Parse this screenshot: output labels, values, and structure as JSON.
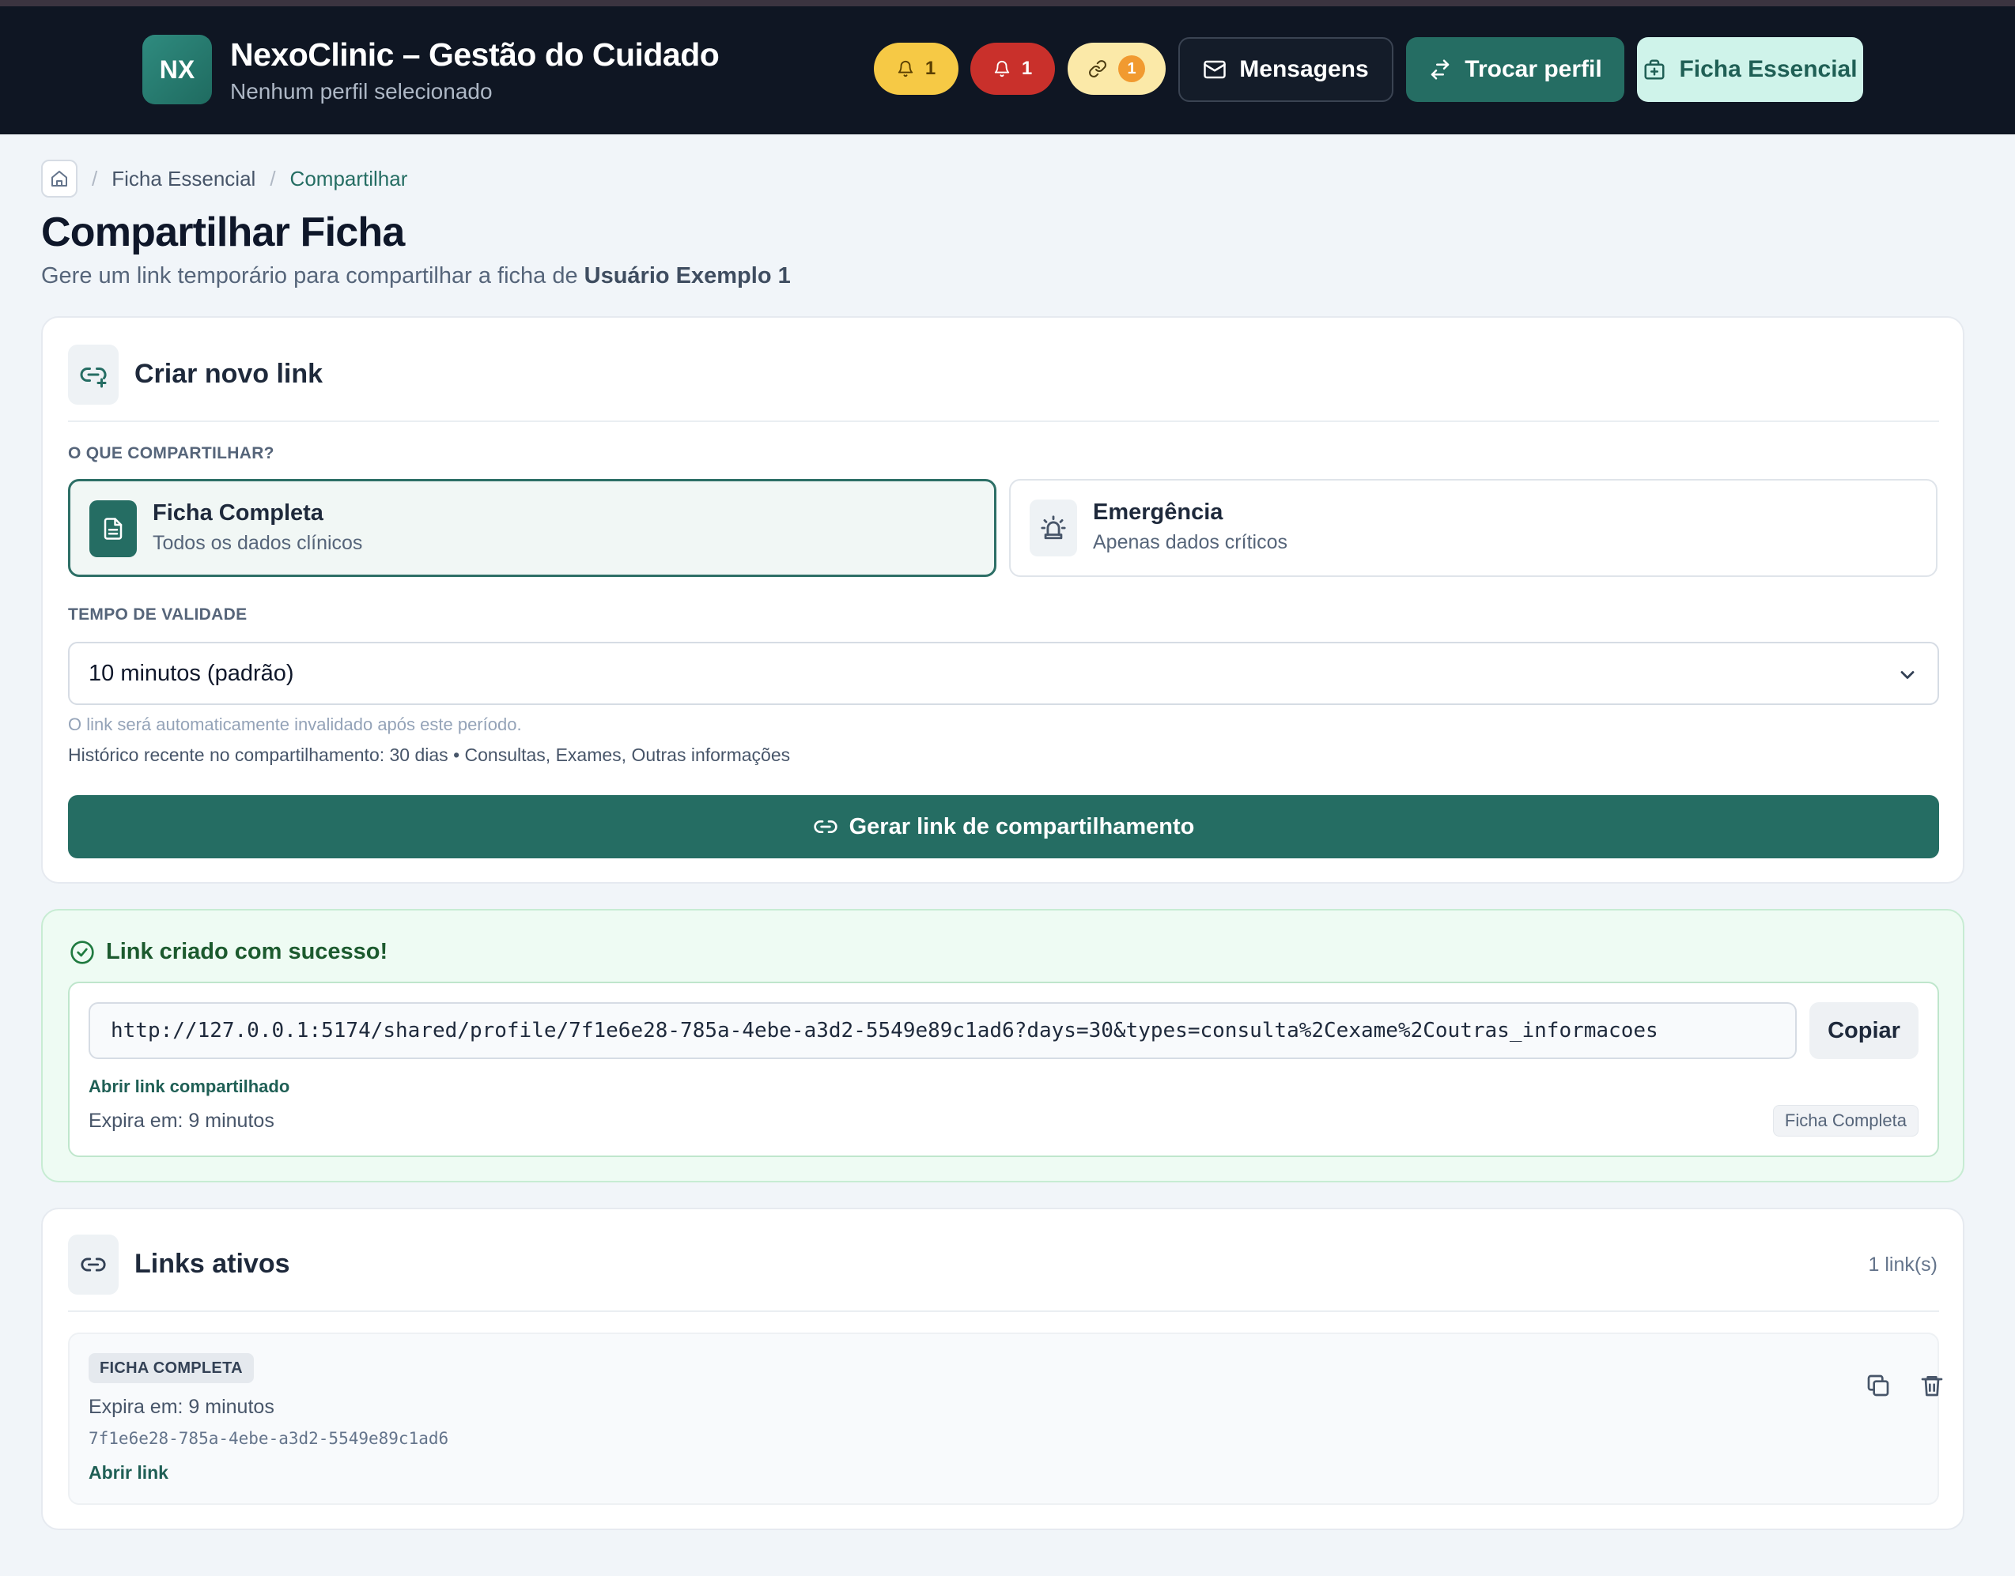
{
  "header": {
    "logo_text": "NX",
    "app_title": "NexoClinic – Gestão do Cuidado",
    "profile_status": "Nenhum perfil selecionado",
    "badges": [
      {
        "icon": "bell-icon",
        "count": "1",
        "color": "#f6c945"
      },
      {
        "icon": "bell-icon",
        "count": "1",
        "color": "#c9302b"
      },
      {
        "icon": "link-icon",
        "count": "1",
        "color": "#fbe9a8"
      }
    ],
    "messages_label": "Mensagens",
    "switch_profile_label": "Trocar perfil",
    "essential_record_label": "Ficha Essencial"
  },
  "breadcrumb": {
    "home_icon": "home-icon",
    "items": [
      "Ficha Essencial",
      "Compartilhar"
    ]
  },
  "page": {
    "title": "Compartilhar Ficha",
    "subtitle_prefix": "Gere um link temporário para compartilhar a ficha de ",
    "user_name": "Usuário Exemplo 1"
  },
  "create_card": {
    "title": "Criar novo link",
    "icon": "link-plus-icon",
    "what_label": "O QUE COMPARTILHAR?",
    "options": [
      {
        "title": "Ficha Completa",
        "desc": "Todos os dados clínicos",
        "icon": "document-icon",
        "selected": true
      },
      {
        "title": "Emergência",
        "desc": "Apenas dados críticos",
        "icon": "siren-icon",
        "selected": false
      }
    ],
    "validity_label": "TEMPO DE VALIDADE",
    "validity_value": "10 minutos (padrão)",
    "validity_hint": "O link será automaticamente invalidado após este período.",
    "history_text": "Histórico recente no compartilhamento: 30 dias • Consultas, Exames, Outras informações",
    "generate_label": "Gerar link de compartilhamento"
  },
  "success_card": {
    "title": "Link criado com sucesso!",
    "url": "http://127.0.0.1:5174/shared/profile/7f1e6e28-785a-4ebe-a3d2-5549e89c1ad6?days=30&types=consulta%2Cexame%2Coutras_informacoes",
    "copy_label": "Copiar",
    "open_label": "Abrir link compartilhado",
    "expires": "Expira em: 9 minutos",
    "type_badge": "Ficha Completa"
  },
  "active_links": {
    "title": "Links ativos",
    "count": "1 link(s)",
    "items": [
      {
        "type": "FICHA COMPLETA",
        "expires": "Expira em: 9 minutos",
        "id": "7f1e6e28-785a-4ebe-a3d2-5549e89c1ad6",
        "open_label": "Abrir link"
      }
    ]
  },
  "colors": {
    "navbar": "#0f1623",
    "primary": "#256d63",
    "success_bg": "#eefbf3",
    "page_bg": "#f1f5f9"
  }
}
